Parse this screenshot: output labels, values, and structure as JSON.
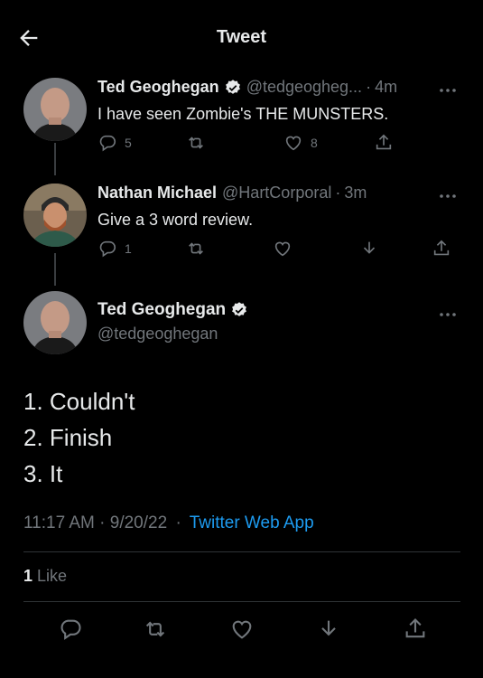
{
  "header": {
    "title": "Tweet"
  },
  "tweets": [
    {
      "name": "Ted Geoghegan",
      "handle": "@tedgeogheg...",
      "time": "4m",
      "text": "I have seen Zombie's THE MUNSTERS.",
      "reply_count": "5",
      "retweet_count": "",
      "like_count": "8",
      "verified": true
    },
    {
      "name": "Nathan Michael",
      "handle": "@HartCorporal",
      "time": "3m",
      "text": "Give a 3 word review.",
      "reply_count": "1",
      "retweet_count": "",
      "like_count": "",
      "verified": false
    }
  ],
  "main_tweet": {
    "name": "Ted Geoghegan",
    "handle": "@tedgeoghegan",
    "lines": [
      "1. Couldn't",
      "2. Finish",
      "3. It"
    ],
    "timestamp": "11:17 AM · 9/20/22",
    "separator": "·",
    "source": "Twitter Web App",
    "likes_count": "1",
    "likes_label": "Like"
  },
  "colors": {
    "background": "#000000",
    "text": "#e7e9ea",
    "muted": "#71767b",
    "link": "#1d9bf0",
    "divider": "#2f3336"
  },
  "icons": [
    "back-arrow-icon",
    "verified-badge-icon",
    "more-icon",
    "reply-icon",
    "retweet-icon",
    "like-icon",
    "download-icon",
    "share-icon"
  ]
}
